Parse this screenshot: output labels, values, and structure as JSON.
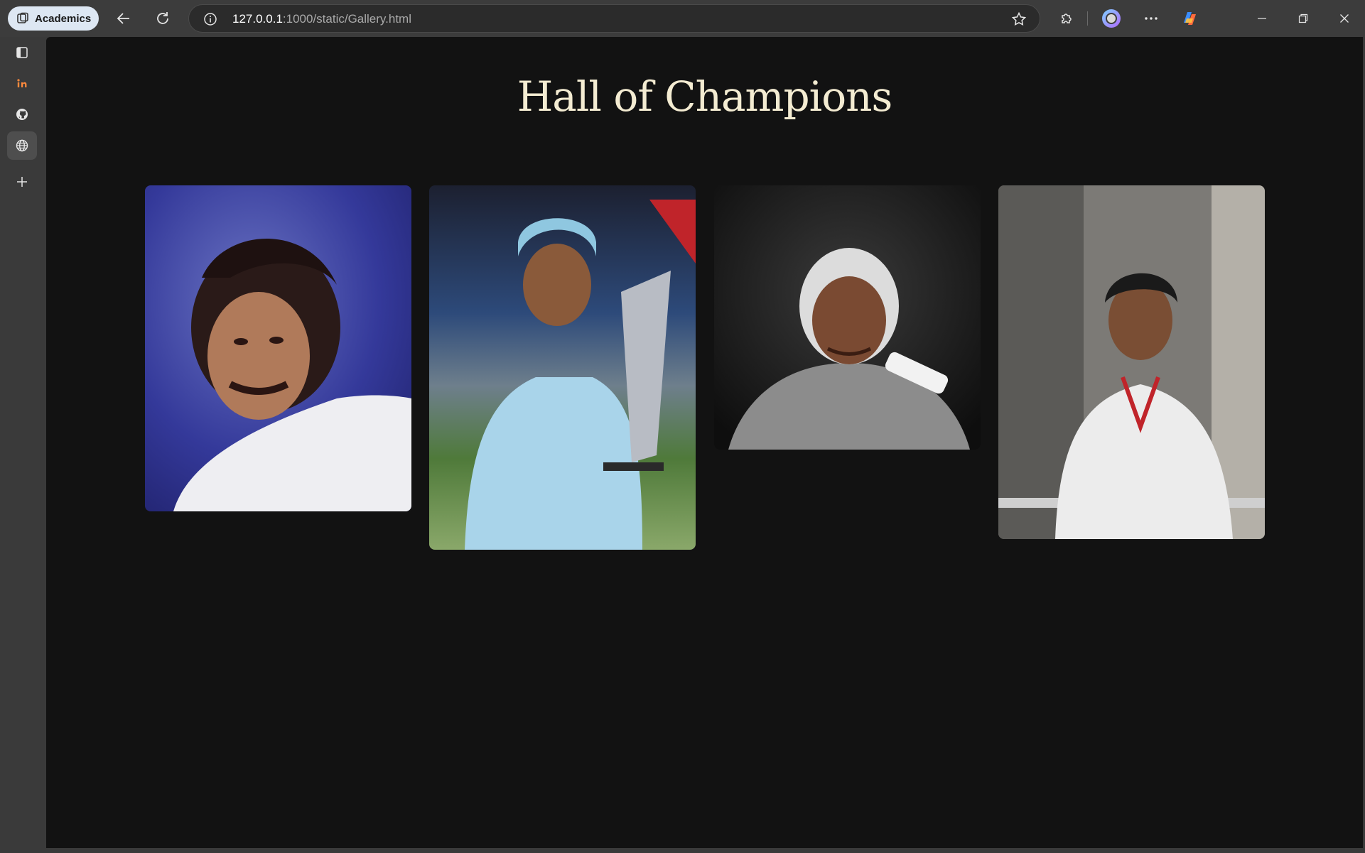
{
  "browser": {
    "profile_label": "Academics",
    "url_host": "127.0.0.1",
    "url_rest": ":1000/static/Gallery.html"
  },
  "page": {
    "title": "Hall of Champions"
  },
  "gallery": {
    "images": [
      {
        "name": "portrait-1"
      },
      {
        "name": "portrait-2"
      },
      {
        "name": "portrait-3"
      },
      {
        "name": "portrait-4"
      }
    ]
  },
  "colors": {
    "page_bg": "#121212",
    "title_color": "#f4ecd2",
    "chrome_bg": "#3c3c3c"
  }
}
